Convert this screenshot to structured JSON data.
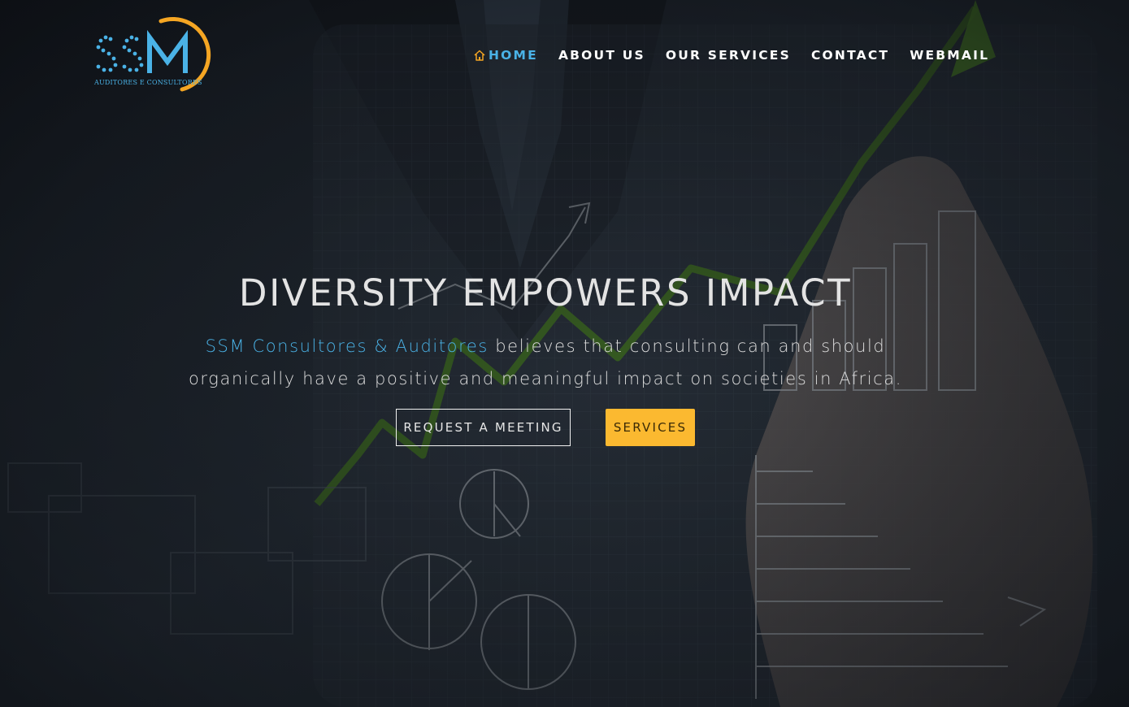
{
  "header": {
    "logo": {
      "wordmark": "SSM",
      "subtitle": "AUDITORES E CONSULTORES",
      "colors": {
        "primary": "#4ab2e6",
        "accent": "#f5a623"
      }
    },
    "nav": {
      "items": [
        {
          "label": "HOME",
          "icon": "home-icon",
          "active": true
        },
        {
          "label": "ABOUT US"
        },
        {
          "label": "OUR SERVICES"
        },
        {
          "label": "CONTACT"
        },
        {
          "label": "WEBMAIL"
        }
      ]
    }
  },
  "hero": {
    "headline": "DIVERSITY EMPOWERS IMPACT",
    "tagline_brand": "SSM Consultores & Auditores",
    "tagline_rest": " believes that consulting can and should organically have a positive and meaningful impact on societies in Africa.",
    "buttons": {
      "request_meeting": "REQUEST A MEETING",
      "services": "SERVICES"
    }
  },
  "colors": {
    "accent_blue": "#4ab2e6",
    "accent_yellow": "#fbb930",
    "text": "#e3e3e3"
  }
}
